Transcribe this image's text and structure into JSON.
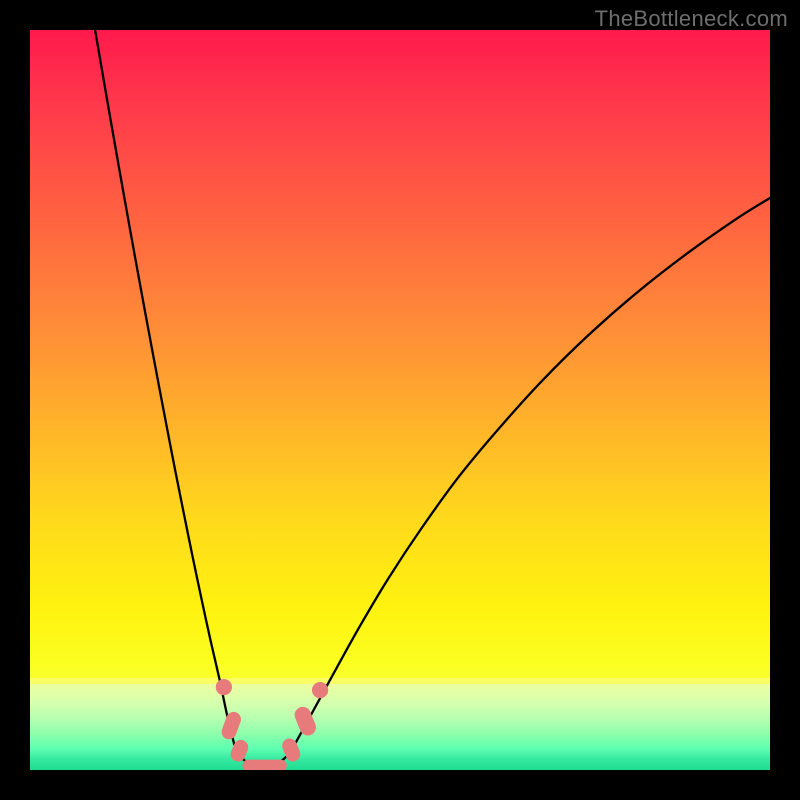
{
  "watermark": "TheBottleneck.com",
  "colors": {
    "frame_bg": "#000000",
    "curve_stroke": "#000000",
    "marker_fill": "#e77b7b",
    "grad_top": "#ff1a4d",
    "grad_mid": "#ffd91c",
    "grad_bottom": "#1edc91"
  },
  "chart_data": {
    "type": "line",
    "title": "",
    "xlabel": "",
    "ylabel": "",
    "xlim": [
      0,
      1
    ],
    "ylim": [
      0,
      1
    ],
    "series": [
      {
        "name": "left_branch",
        "x": [
          0.088,
          0.1,
          0.112,
          0.124,
          0.136,
          0.148,
          0.16,
          0.172,
          0.184,
          0.196,
          0.208,
          0.22,
          0.232,
          0.244,
          0.256,
          0.264,
          0.27,
          0.276
        ],
        "y": [
          1.0,
          0.93,
          0.861,
          0.793,
          0.726,
          0.66,
          0.595,
          0.531,
          0.468,
          0.406,
          0.346,
          0.287,
          0.23,
          0.175,
          0.123,
          0.085,
          0.058,
          0.035
        ]
      },
      {
        "name": "valley_floor",
        "x": [
          0.276,
          0.285,
          0.297,
          0.31,
          0.323,
          0.336,
          0.348,
          0.358
        ],
        "y": [
          0.035,
          0.018,
          0.008,
          0.004,
          0.005,
          0.01,
          0.02,
          0.035
        ]
      },
      {
        "name": "right_branch",
        "x": [
          0.358,
          0.38,
          0.41,
          0.445,
          0.485,
          0.53,
          0.58,
          0.635,
          0.693,
          0.755,
          0.82,
          0.888,
          0.958,
          1.0
        ],
        "y": [
          0.035,
          0.075,
          0.13,
          0.193,
          0.26,
          0.328,
          0.397,
          0.463,
          0.527,
          0.588,
          0.645,
          0.698,
          0.747,
          0.773
        ]
      }
    ],
    "markers": [
      {
        "shape": "circle",
        "cx": 0.262,
        "cy": 0.112,
        "r": 0.011
      },
      {
        "shape": "capsule",
        "cx": 0.272,
        "cy": 0.06,
        "w": 0.02,
        "h": 0.038,
        "rot": 20
      },
      {
        "shape": "capsule",
        "cx": 0.283,
        "cy": 0.026,
        "w": 0.02,
        "h": 0.03,
        "rot": 22
      },
      {
        "shape": "capsule",
        "cx": 0.317,
        "cy": 0.006,
        "w": 0.06,
        "h": 0.016,
        "rot": 0
      },
      {
        "shape": "capsule",
        "cx": 0.353,
        "cy": 0.027,
        "w": 0.02,
        "h": 0.032,
        "rot": -22
      },
      {
        "shape": "capsule",
        "cx": 0.372,
        "cy": 0.066,
        "w": 0.022,
        "h": 0.04,
        "rot": -22
      },
      {
        "shape": "circle",
        "cx": 0.392,
        "cy": 0.108,
        "r": 0.011
      }
    ]
  }
}
